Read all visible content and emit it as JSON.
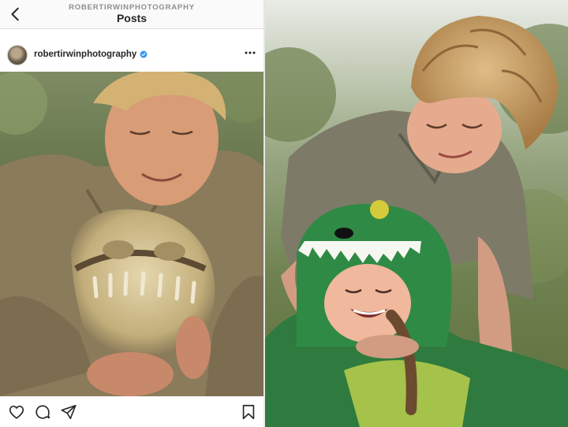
{
  "nav": {
    "username": "ROBERTIRWINPHOTOGRAPHY",
    "title": "Posts",
    "back_icon": "chevron-left-icon"
  },
  "post": {
    "author": "robertirwinphotography",
    "verified": true,
    "more_icon": "more-horizontal-icon"
  },
  "actions": {
    "icons": [
      "heart-icon",
      "comment-icon",
      "share-icon",
      "bookmark-icon"
    ]
  },
  "colors": {
    "verified_blue": "#3897f0",
    "text_primary": "#262626",
    "text_secondary": "#8e8e8e",
    "divider": "#dbdbdb"
  }
}
